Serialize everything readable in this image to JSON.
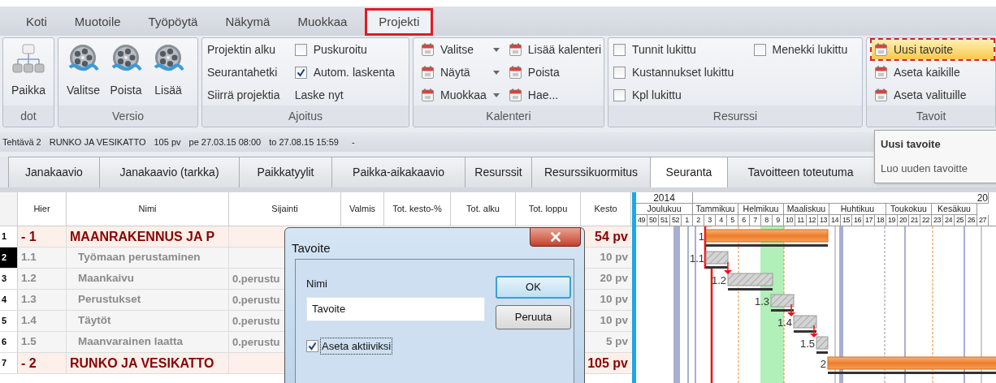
{
  "menu_tabs": [
    {
      "label": "Koti",
      "selected": false
    },
    {
      "label": "Muotoile",
      "selected": false
    },
    {
      "label": "Työpöytä",
      "selected": false
    },
    {
      "label": "Näkymä",
      "selected": false
    },
    {
      "label": "Muokkaa",
      "selected": false
    },
    {
      "label": "Projekti",
      "selected": true
    }
  ],
  "ribbon": [
    {
      "title": "dot",
      "columns": [
        [
          {
            "kind": "org",
            "label": "Paikka"
          }
        ]
      ]
    },
    {
      "title": "Versio",
      "columns": [
        [
          {
            "kind": "reel",
            "label": "Valitse"
          }
        ],
        [
          {
            "kind": "reel",
            "label": "Poista"
          }
        ],
        [
          {
            "kind": "reel",
            "label": "Lisää"
          }
        ]
      ]
    },
    {
      "title": "Ajoitus",
      "columns": [
        [
          {
            "kind": "link",
            "label": "Projektin alku"
          },
          {
            "kind": "link",
            "label": "Seurantahetki"
          },
          {
            "kind": "link",
            "label": "Siirrä projektia"
          }
        ],
        [
          {
            "kind": "checkbox",
            "label": "Puskuroitu",
            "checked": false
          },
          {
            "kind": "checkbox",
            "label": "Autom. laskenta",
            "checked": true
          },
          {
            "kind": "link",
            "label": "Laske nyt"
          }
        ]
      ]
    },
    {
      "title": "Kalenteri",
      "columns": [
        [
          {
            "kind": "calendar-menu",
            "label": "Valitse"
          },
          {
            "kind": "calendar-menu",
            "label": "Näytä"
          },
          {
            "kind": "calendar-menu",
            "label": "Muokkaa"
          }
        ],
        [
          {
            "kind": "calendar",
            "label": "Lisää kalenteri",
            "highlighted": false
          },
          {
            "kind": "calendar",
            "label": "Poista",
            "highlighted": false
          },
          {
            "kind": "calendar",
            "label": "Hae...",
            "highlighted": false
          }
        ]
      ]
    },
    {
      "title": "Resurssi",
      "columns": [
        [
          {
            "kind": "checkbox",
            "label": "Tunnit lukittu",
            "checked": false
          },
          {
            "kind": "checkbox",
            "label": "Kustannukset lukittu",
            "checked": false
          },
          {
            "kind": "checkbox",
            "label": "Kpl lukittu",
            "checked": false
          }
        ],
        [
          {
            "kind": "checkbox",
            "label": "Menekki lukittu",
            "checked": false
          }
        ]
      ]
    },
    {
      "title": "Tavoit",
      "columns": [
        [
          {
            "kind": "calendar",
            "label": "Uusi tavoite",
            "highlighted": true
          },
          {
            "kind": "calendar",
            "label": "Aseta kaikille",
            "highlighted": false
          },
          {
            "kind": "calendar",
            "label": "Aseta valituille",
            "highlighted": false
          }
        ]
      ]
    }
  ],
  "status_bar": {
    "task": "Tehtävä 2",
    "name": "RUNKO JA VESIKATTO",
    "duration": "105 pv",
    "start": "pe 27.03.15 08:00",
    "end": "to 27.08.15 15:59",
    "extra": "-"
  },
  "tooltip": {
    "title": "Uusi tavoite",
    "text": "Luo uuden tavoitte"
  },
  "view_tabs": [
    {
      "label": "Janakaavio",
      "selected": false
    },
    {
      "label": "Janakaavio (tarkka)",
      "selected": false
    },
    {
      "label": "Paikkatyylit",
      "selected": false
    },
    {
      "label": "Paikka-aikakaavio",
      "selected": false
    },
    {
      "label": "Resurssit",
      "selected": false
    },
    {
      "label": "Resurssikuormitus",
      "selected": false
    },
    {
      "label": "Seuranta",
      "selected": true
    },
    {
      "label": "Tavoitteen toteutuma",
      "selected": false
    }
  ],
  "table": {
    "columns": [
      "Hier",
      "Nimi",
      "Sijainti",
      "Valmis",
      "Tot. kesto-%",
      "Tot. alku",
      "Tot. loppu",
      "Kesto"
    ],
    "rows": [
      {
        "number": "1",
        "hier": "- 1",
        "name": "MAANRAKENNUS JA P",
        "duration": "54 pv",
        "kind": "summary",
        "selected": false
      },
      {
        "number": "2",
        "hier": "1.1",
        "name": "Työmaan perustaminen",
        "duration": "10 pv",
        "kind": "task",
        "selected": true
      },
      {
        "number": "3",
        "hier": "1.2",
        "name": "Maankaivu",
        "location": "0.perustu",
        "duration": "20 pv",
        "kind": "task",
        "selected": false
      },
      {
        "number": "4",
        "hier": "1.3",
        "name": "Perustukset",
        "location": "0.perustu",
        "duration": "10 pv",
        "kind": "task",
        "selected": false
      },
      {
        "number": "5",
        "hier": "1.4",
        "name": "Täytöt",
        "location": "0.perustu",
        "duration": "10 pv",
        "kind": "task",
        "selected": false
      },
      {
        "number": "6",
        "hier": "1.5",
        "name": "Maanvarainen laatta",
        "location": "0.perustu",
        "duration": "5 pv",
        "kind": "task",
        "selected": false
      },
      {
        "number": "7",
        "hier": "- 2",
        "name": "RUNKO JA VESIKATTO",
        "duration": "105 pv",
        "kind": "summary",
        "selected": false
      }
    ]
  },
  "gantt": {
    "years": [
      "2014",
      "20"
    ],
    "months": [
      "Joulukuu",
      "Tammikuu",
      "Helmikuu",
      "Maaliskuu",
      "Huhtikuu",
      "Toukokuu",
      "Kesäkuu"
    ],
    "weeks": [
      "49",
      "50",
      "51",
      "52",
      "1",
      "2",
      "3",
      "4",
      "5",
      "6",
      "7",
      "8",
      "9",
      "10",
      "11",
      "12",
      "13",
      "14",
      "15",
      "16",
      "17",
      "18",
      "19",
      "20",
      "21",
      "22",
      "23",
      "24",
      "25",
      "26",
      "27"
    ],
    "bars": [
      {
        "label": "1",
        "kind": "summary"
      },
      {
        "label": "1.1",
        "kind": "task"
      },
      {
        "label": "1.2",
        "kind": "task"
      },
      {
        "label": "1.3",
        "kind": "task"
      },
      {
        "label": "1.4",
        "kind": "task"
      },
      {
        "label": "1.5",
        "kind": "task"
      },
      {
        "label": "2",
        "kind": "summary"
      }
    ]
  },
  "dialog": {
    "title": "Tavoite",
    "name_label": "Nimi",
    "name_value": "Tavoite",
    "ok": "OK",
    "cancel": "Peruuta",
    "activate": {
      "label": "Aseta aktiiviksi",
      "checked": true
    }
  }
}
